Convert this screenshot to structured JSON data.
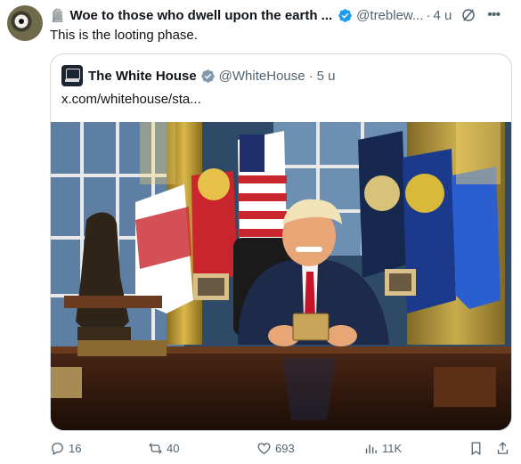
{
  "author": {
    "emoji": "🪦",
    "name": "Woe to those who dwell upon the earth ...",
    "handle": "@treblew...",
    "separator": "·",
    "time": "4 u"
  },
  "post": {
    "text": "This is the looting phase."
  },
  "quoted": {
    "name": "The White House",
    "handle": "@WhiteHouse",
    "separator": "·",
    "time": "5 u",
    "text": "x.com/whitehouse/sta...",
    "photo_alt": "Official photo in the Oval Office"
  },
  "actions": {
    "replies": "16",
    "reposts": "40",
    "likes": "693",
    "views": "11K"
  },
  "colors": {
    "verified": "#1d9bf0",
    "gov_badge": "#829aab",
    "muted": "#536471"
  }
}
